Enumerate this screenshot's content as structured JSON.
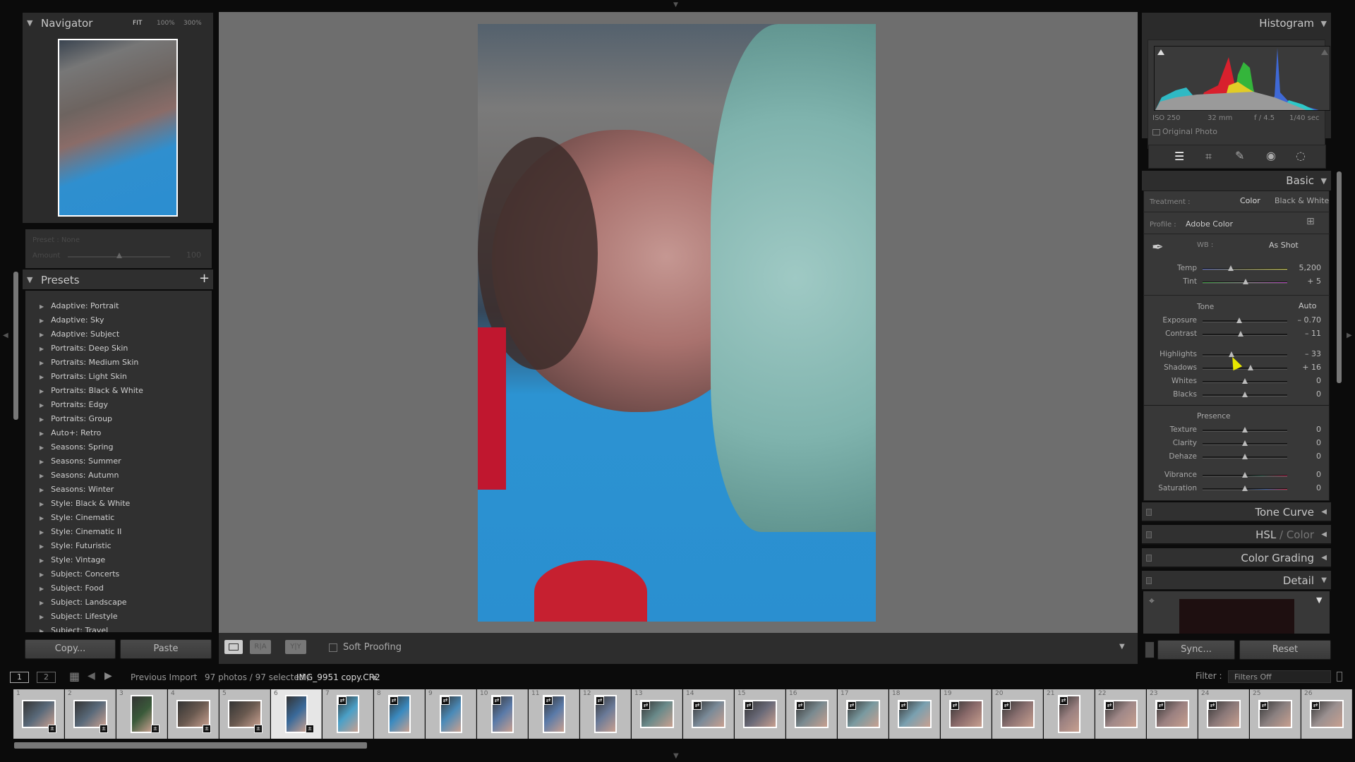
{
  "navigator": {
    "title": "Navigator",
    "zoom_fit": "FIT",
    "zoom_100": "100%",
    "zoom_300": "300%"
  },
  "preset_amount": {
    "label_name": "Preset : None",
    "amount_label": "Amount",
    "amount_value": "100",
    "amount_fraction": 0.5
  },
  "presets": {
    "title": "Presets",
    "add_icon": "plus-icon",
    "items": [
      "Adaptive: Portrait",
      "Adaptive: Sky",
      "Adaptive: Subject",
      "Portraits: Deep Skin",
      "Portraits: Medium Skin",
      "Portraits: Light Skin",
      "Portraits: Black & White",
      "Portraits: Edgy",
      "Portraits: Group",
      "Auto+: Retro",
      "Seasons: Spring",
      "Seasons: Summer",
      "Seasons: Autumn",
      "Seasons: Winter",
      "Style: Black & White",
      "Style: Cinematic",
      "Style: Cinematic II",
      "Style: Futuristic",
      "Style: Vintage",
      "Subject: Concerts",
      "Subject: Food",
      "Subject: Landscape",
      "Subject: Lifestyle",
      "Subject: Travel"
    ]
  },
  "left_buttons": {
    "copy": "Copy...",
    "paste": "Paste"
  },
  "toolbar": {
    "soft_proofing": "Soft Proofing",
    "view_before_after": "R|A",
    "view_yy": "Y|Y"
  },
  "histogram": {
    "title": "Histogram",
    "iso": "ISO 250",
    "focal": "32 mm",
    "aperture": "f / 4.5",
    "shutter": "1/40 sec",
    "original_photo": "Original Photo"
  },
  "tools": [
    "sliders-icon",
    "crop-icon",
    "healing-icon",
    "redeye-icon",
    "masking-icon"
  ],
  "basic": {
    "title": "Basic",
    "treatment_label": "Treatment :",
    "treatment_color": "Color",
    "treatment_bw": "Black & White",
    "profile_label": "Profile :",
    "profile_value": "Adobe Color",
    "wb_label": "WB :",
    "wb_value": "As Shot",
    "tone_label": "Tone",
    "auto_label": "Auto",
    "presence_label": "Presence",
    "wb_sliders": [
      {
        "label": "Temp",
        "value": "5,200",
        "pos": 0.33
      },
      {
        "label": "Tint",
        "value": "+ 5",
        "pos": 0.51
      }
    ],
    "tone_sliders": [
      {
        "label": "Exposure",
        "value": "– 0.70",
        "pos": 0.43
      },
      {
        "label": "Contrast",
        "value": "– 11",
        "pos": 0.45
      }
    ],
    "tone_sliders2": [
      {
        "label": "Highlights",
        "value": "– 33",
        "pos": 0.34
      },
      {
        "label": "Shadows",
        "value": "+ 16",
        "pos": 0.57
      },
      {
        "label": "Whites",
        "value": "0",
        "pos": 0.5
      },
      {
        "label": "Blacks",
        "value": "0",
        "pos": 0.5
      }
    ],
    "presence_sliders": [
      {
        "label": "Texture",
        "value": "0",
        "pos": 0.5
      },
      {
        "label": "Clarity",
        "value": "0",
        "pos": 0.5
      },
      {
        "label": "Dehaze",
        "value": "0",
        "pos": 0.5
      }
    ],
    "color_sliders": [
      {
        "label": "Vibrance",
        "value": "0",
        "pos": 0.5
      },
      {
        "label": "Saturation",
        "value": "0",
        "pos": 0.5
      }
    ]
  },
  "sections": {
    "tone_curve": "Tone Curve",
    "hsl": "HSL",
    "hsl_sep": " / ",
    "color": "Color",
    "color_grading": "Color Grading",
    "detail": "Detail"
  },
  "right_buttons": {
    "sync": "Sync...",
    "reset": "Reset"
  },
  "filmstrip": {
    "screen1": "1",
    "screen2": "2",
    "source": "Previous Import",
    "count": "97 photos / 97 selected /",
    "filename": "IMG_9951 copy.CR2",
    "filter_label": "Filter :",
    "filter_value": "Filters Off",
    "selected_index": 6,
    "thumbs": [
      "1",
      "2",
      "3",
      "4",
      "5",
      "6",
      "7",
      "8",
      "9",
      "10",
      "11",
      "12",
      "13",
      "14",
      "15",
      "16",
      "17",
      "18",
      "19",
      "20",
      "21",
      "22",
      "23",
      "24",
      "25",
      "26"
    ]
  },
  "colors": {
    "accent_cursor": "#e8e800",
    "panel": "#2b2b2b",
    "center_bg": "#6e6e6e"
  }
}
